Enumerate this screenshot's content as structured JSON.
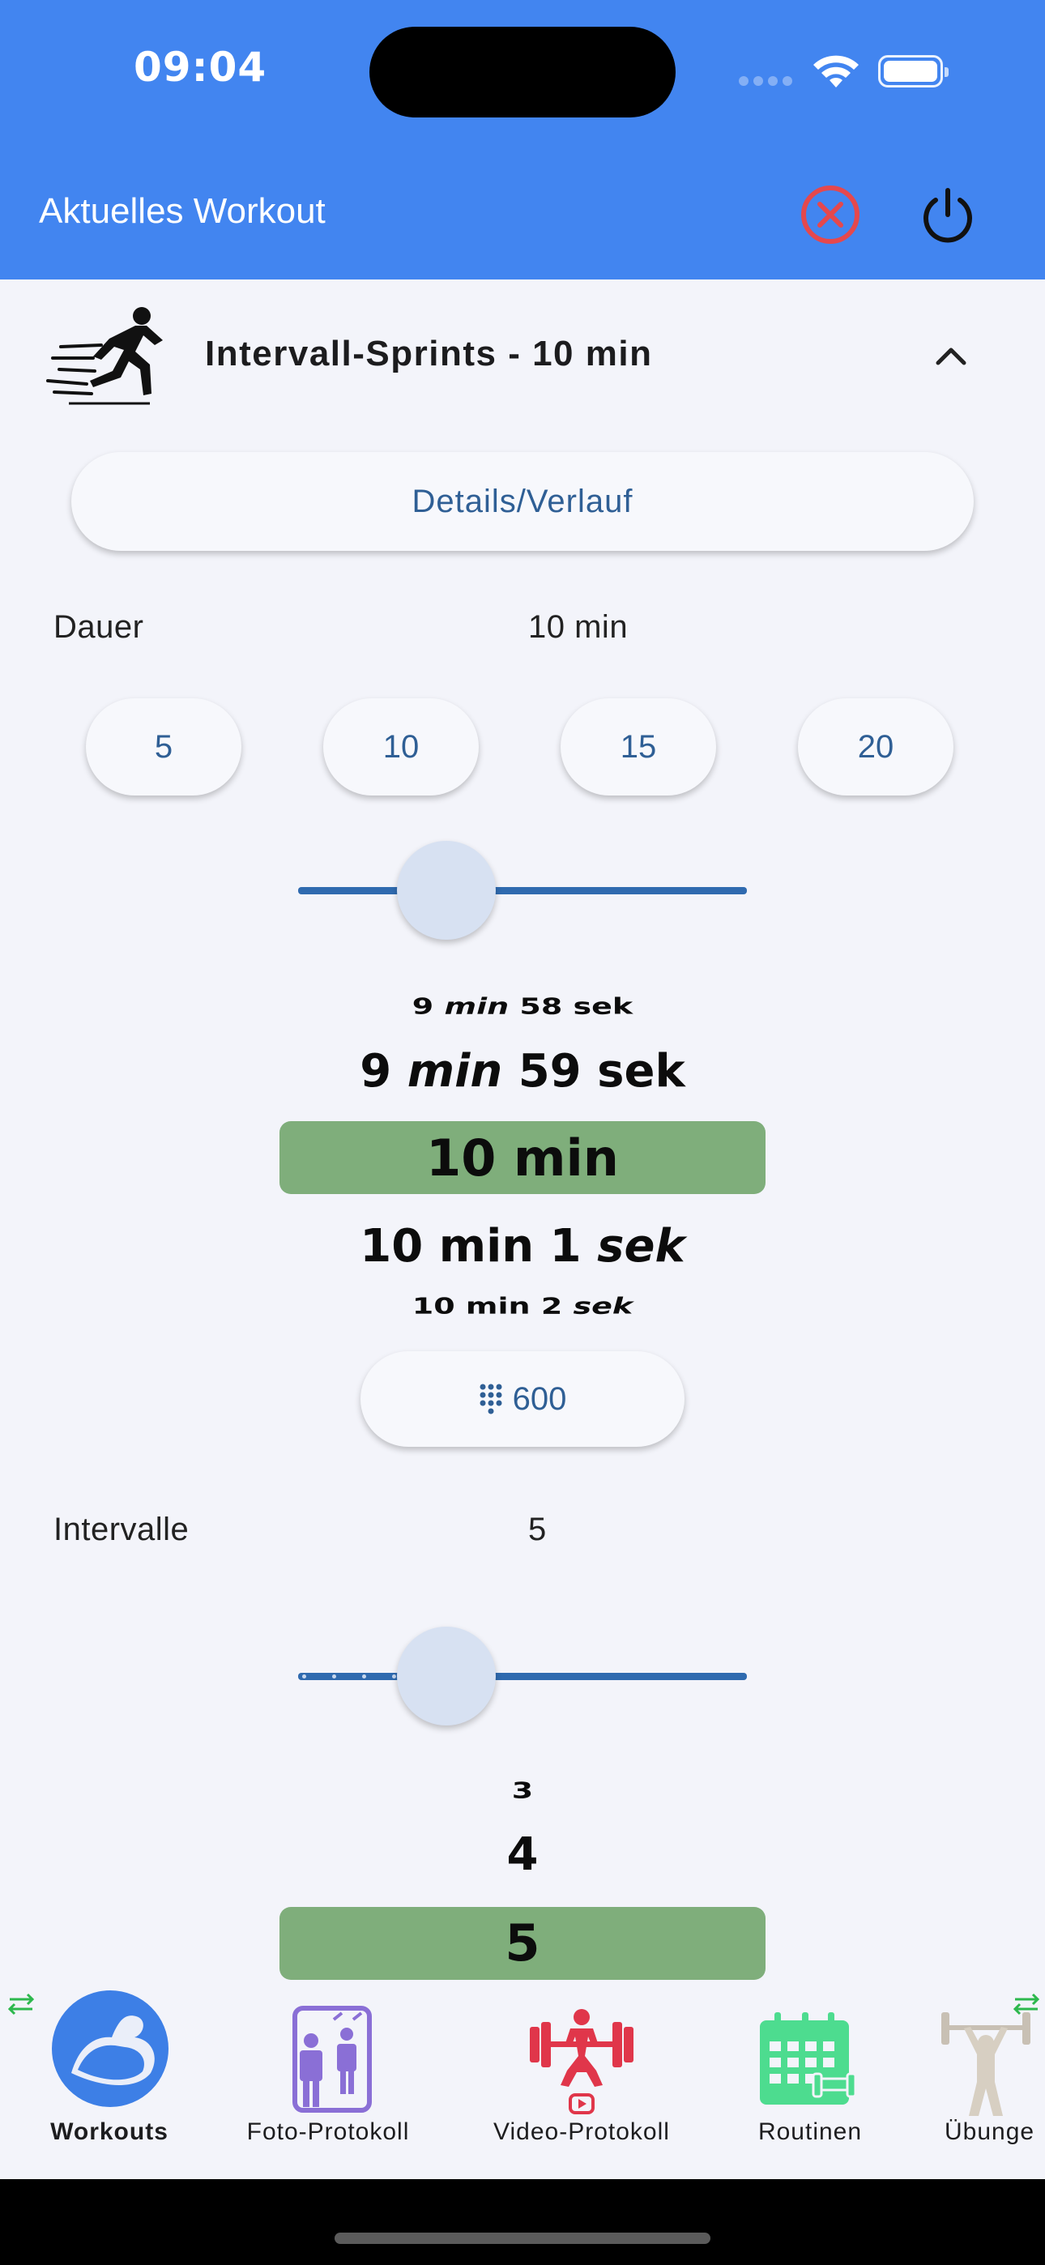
{
  "status_bar": {
    "time": "09:04"
  },
  "header": {
    "title": "Aktuelles Workout",
    "close_icon": "close-circle-icon",
    "power_icon": "power-icon"
  },
  "workout": {
    "name": "Intervall-Sprints - 10 min",
    "icon": "sprinter-icon",
    "details_button": "Details/Verlauf",
    "duration": {
      "label": "Dauer",
      "value": "10 min",
      "presets": [
        "5",
        "10",
        "15",
        "20"
      ],
      "slider_fraction": 0.33,
      "picker": {
        "prev2": {
          "a": "9",
          "b": "min",
          "c": "58",
          "d": "sek"
        },
        "prev1": {
          "a": "9",
          "b": "min",
          "c": "59",
          "d": "sek"
        },
        "selected": "10 min",
        "next1": {
          "a": "10",
          "b": "min",
          "c": "1",
          "d": "sek"
        },
        "next2": {
          "a": "10",
          "b": "min",
          "c": "2",
          "d": "sek"
        }
      },
      "numpad_value": "600"
    },
    "intervals": {
      "label": "Intervalle",
      "value": "5",
      "slider_fraction": 0.33,
      "picker": {
        "prev2": "3",
        "prev1": "4",
        "selected": "5"
      }
    }
  },
  "tabs": [
    {
      "label": "Workouts",
      "icon": "biceps-icon",
      "active": true
    },
    {
      "label": "Foto-Protokoll",
      "icon": "mirror-photo-icon",
      "active": false
    },
    {
      "label": "Video-Protokoll",
      "icon": "weightlifter-video-icon",
      "active": false
    },
    {
      "label": "Routinen",
      "icon": "calendar-icon",
      "active": false
    },
    {
      "label": "Übunge",
      "icon": "barbell-person-icon",
      "active": false
    }
  ],
  "colors": {
    "header": "#4285f0",
    "accent_blue": "#2f5f95",
    "picker_selected": "#7fae7b",
    "close_red": "#e5484d"
  }
}
